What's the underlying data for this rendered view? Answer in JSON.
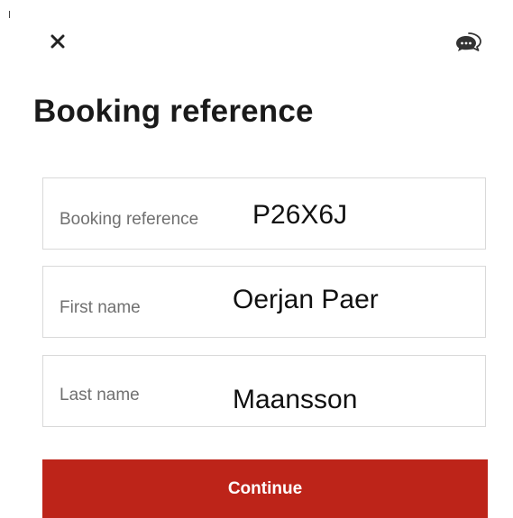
{
  "header": {
    "close_icon": "close-icon",
    "chat_icon": "chat-support-icon"
  },
  "page_title": "Booking reference",
  "form": {
    "fields": [
      {
        "label": "Booking reference",
        "value": "P26X6J"
      },
      {
        "label": "First name",
        "value": "Oerjan Paer"
      },
      {
        "label": "Last name",
        "value": "Maansson"
      }
    ]
  },
  "continue_label": "Continue",
  "colors": {
    "accent": "#bd2419",
    "field_border": "#d9d9d9",
    "label_text": "#707070"
  }
}
